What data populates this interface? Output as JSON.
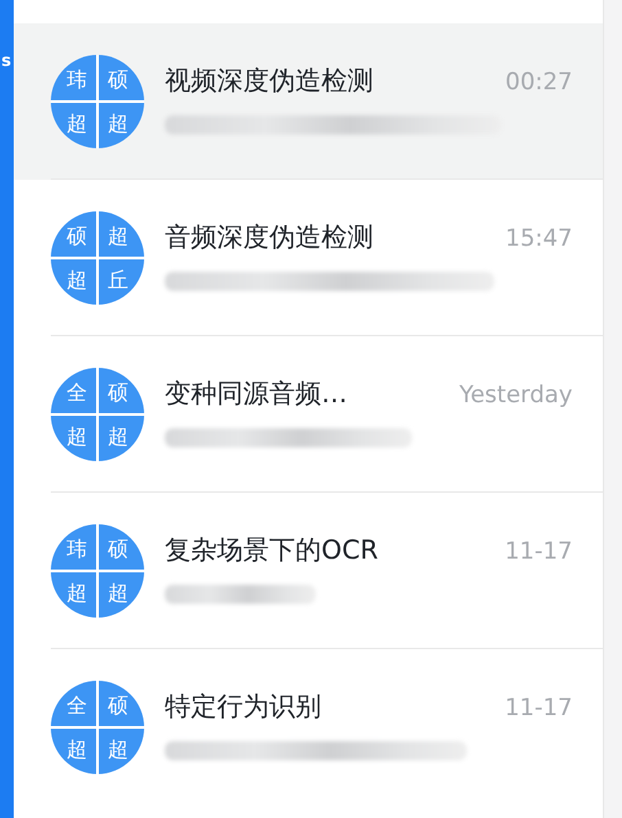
{
  "side_strip": {
    "text": "s"
  },
  "chats": [
    {
      "avatar": [
        "玮",
        "硕",
        "超",
        "超"
      ],
      "title": "视频深度伪造检测",
      "time": "00:27",
      "selected": true
    },
    {
      "avatar": [
        "硕",
        "超",
        "超",
        "丘"
      ],
      "title": "音频深度伪造检测",
      "time": "15:47",
      "selected": false
    },
    {
      "avatar": [
        "全",
        "硕",
        "超",
        "超"
      ],
      "title": "变种同源音频…",
      "time": "Yesterday",
      "selected": false
    },
    {
      "avatar": [
        "玮",
        "硕",
        "超",
        "超"
      ],
      "title": "复杂场景下的OCR",
      "time": "11-17",
      "selected": false
    },
    {
      "avatar": [
        "全",
        "硕",
        "超",
        "超"
      ],
      "title": "特定行为识别",
      "time": "11-17",
      "selected": false
    }
  ]
}
